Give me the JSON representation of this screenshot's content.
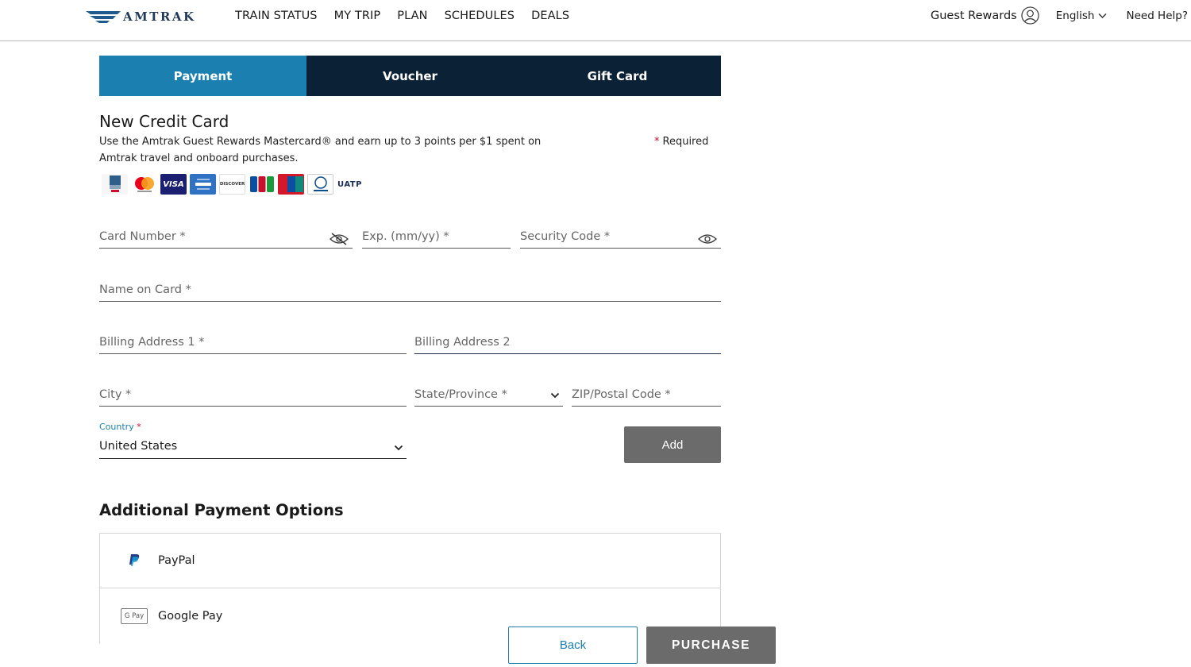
{
  "header": {
    "brand": "AMTRAK",
    "nav": [
      "TRAIN STATUS",
      "MY TRIP",
      "PLAN",
      "SCHEDULES",
      "DEALS"
    ],
    "guest_rewards": "Guest Rewards",
    "language": "English",
    "help": "Need Help?"
  },
  "tabs": [
    {
      "label": "Payment",
      "active": true
    },
    {
      "label": "Voucher",
      "active": false
    },
    {
      "label": "Gift Card",
      "active": false
    }
  ],
  "card_form": {
    "title": "New Credit Card",
    "promo": "Use the Amtrak Guest Rewards Mastercard® and earn up to 3 points per $1 spent on Amtrak travel and onboard purchases.",
    "required_star": "*",
    "required": "Required",
    "card_logos": [
      "guest-rewards-card",
      "mastercard",
      "visa",
      "american-express",
      "discover",
      "jcb",
      "unionpay",
      "diners-club",
      "uatp"
    ],
    "logo_text": {
      "visa": "VISA",
      "discover": "DISCOVER",
      "jcb": "JCB",
      "uatp": "UATP"
    },
    "fields": {
      "card_number": "Card Number *",
      "exp": "Exp. (mm/yy) *",
      "security_code": "Security Code *",
      "name_on_card": "Name on Card *",
      "billing_address_1": "Billing Address 1 *",
      "billing_address_2": "Billing Address 2",
      "city": "City *",
      "state": "State/Province *",
      "zip": "ZIP/Postal Code *",
      "country_label": "Country",
      "country_star": "*",
      "country_value": "United States"
    },
    "add_button": "Add"
  },
  "additional": {
    "title": "Additional Payment Options",
    "options": [
      {
        "label": "PayPal",
        "icon": "paypal-icon"
      },
      {
        "label": "Google Pay",
        "icon": "google-pay-icon",
        "badge": "G Pay"
      }
    ]
  },
  "actions": {
    "back": "Back",
    "purchase": "PURCHASE"
  },
  "colors": {
    "tab_active": "#1b80af",
    "tab_bar": "#0b2236",
    "button_gray": "#6b6b6b",
    "required_red": "#c8102e"
  }
}
